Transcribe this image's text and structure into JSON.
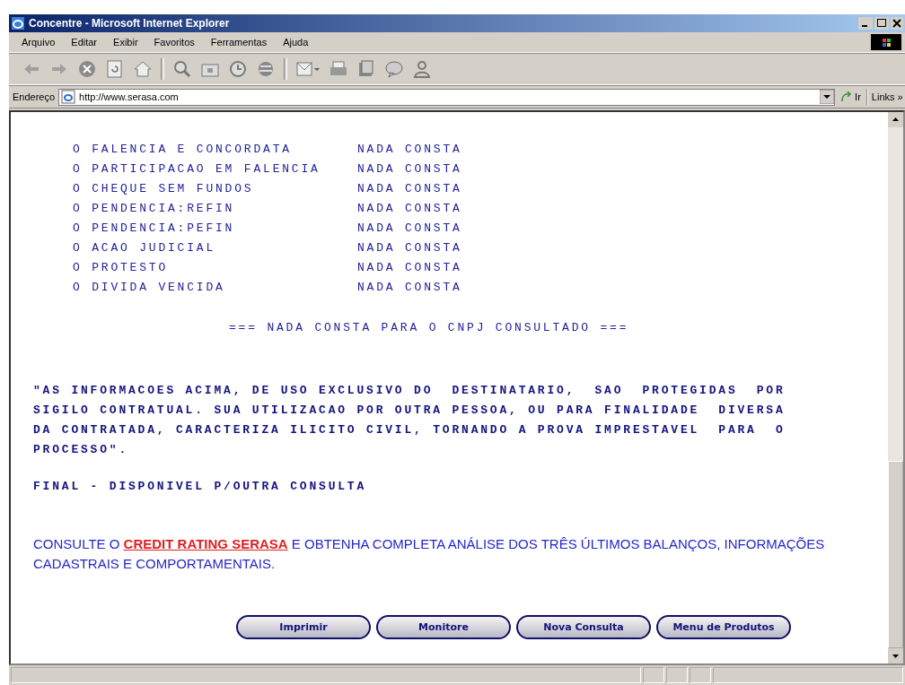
{
  "window": {
    "title": "Concentre - Microsoft Internet Explorer"
  },
  "menu": [
    "Arquivo",
    "Editar",
    "Exibir",
    "Favoritos",
    "Ferramentas",
    "Ajuda"
  ],
  "address_bar": {
    "label": "Endereço",
    "value": "http://www.serasa.com",
    "go": "Ir",
    "links": "Links »"
  },
  "report_rows": [
    {
      "label": "O FALENCIA E CONCORDATA",
      "value": "NADA CONSTA"
    },
    {
      "label": "O PARTICIPACAO EM FALENCIA",
      "value": "NADA CONSTA"
    },
    {
      "label": "O CHEQUE SEM FUNDOS",
      "value": "NADA CONSTA"
    },
    {
      "label": "O PENDENCIA:REFIN",
      "value": "NADA CONSTA"
    },
    {
      "label": "O PENDENCIA:PEFIN",
      "value": "NADA CONSTA"
    },
    {
      "label": "O ACAO JUDICIAL",
      "value": "NADA CONSTA"
    },
    {
      "label": "O PROTESTO",
      "value": "NADA CONSTA"
    },
    {
      "label": "O DIVIDA VENCIDA",
      "value": "NADA CONSTA"
    }
  ],
  "summary": "=== NADA CONSTA PARA O CNPJ CONSULTADO ===",
  "notice": "\"AS INFORMACOES ACIMA, DE USO EXCLUSIVO DO  DESTINATARIO,  SAO  PROTEGIDAS  POR\nSIGILO CONTRATUAL. SUA UTILIZACAO POR OUTRA PESSOA, OU PARA FINALIDADE  DIVERSA\nDA CONTRATADA, CARACTERIZA ILICITO CIVIL, TORNANDO A PROVA IMPRESTAVEL  PARA  O\nPROCESSO\".",
  "final": "FINAL - DISPONIVEL P/OUTRA CONSULTA",
  "promo": {
    "before": "CONSULTE O",
    "link": "CREDIT RATING SERASA",
    "after": "E OBTENHA COMPLETA ANÁLISE DOS TRÊS ÚLTIMOS BALANÇOS, INFORMAÇÕES CADASTRAIS E COMPORTAMENTAIS."
  },
  "buttons": [
    "Imprimir",
    "Monitore",
    "Nova Consulta",
    "Menu de Produtos"
  ]
}
